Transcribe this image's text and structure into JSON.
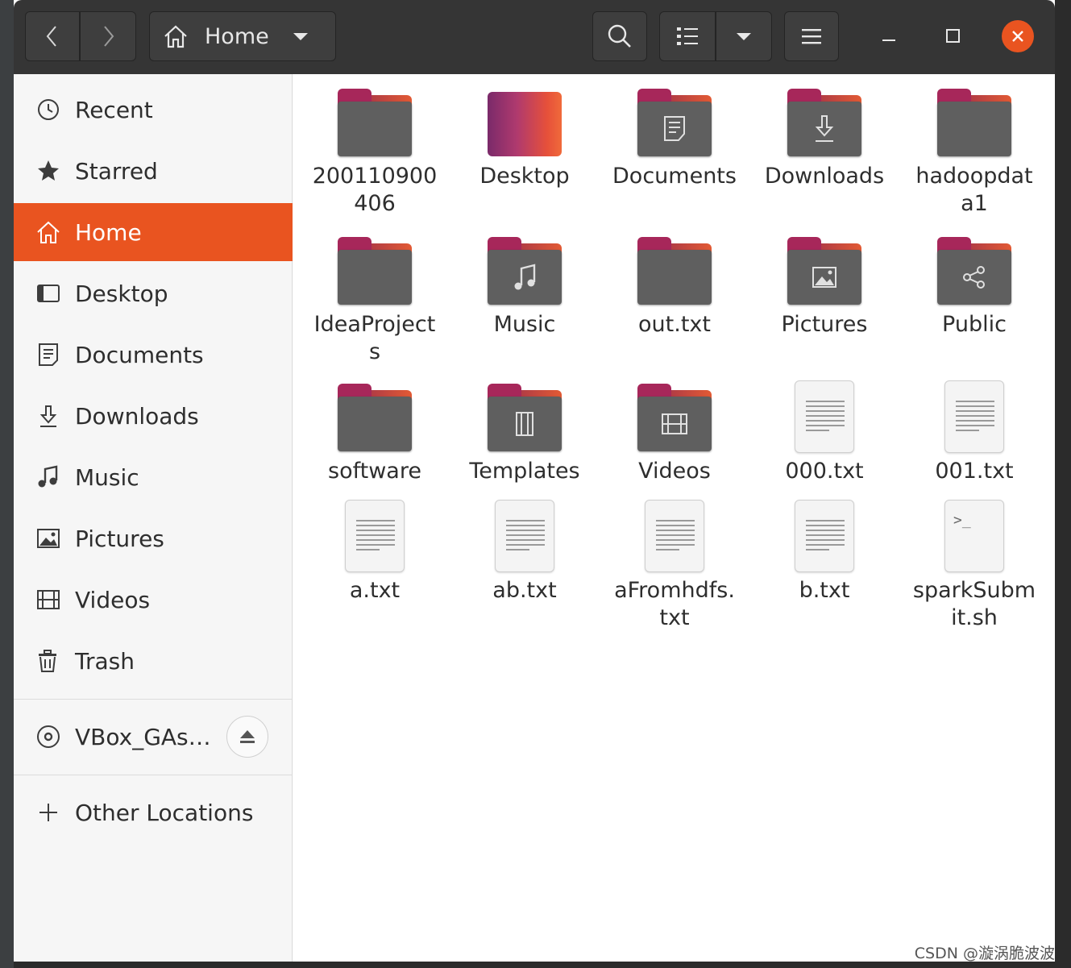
{
  "headerbar": {
    "path_label": "Home",
    "back_icon": "chevron-left-icon",
    "forward_icon": "chevron-right-icon",
    "search_icon": "search-icon",
    "view_icon": "list-view-icon",
    "menu_icon": "hamburger-menu-icon",
    "close_color": "#e95420"
  },
  "sidebar": {
    "items": [
      {
        "label": "Recent",
        "icon": "clock-icon"
      },
      {
        "label": "Starred",
        "icon": "star-icon"
      },
      {
        "label": "Home",
        "icon": "home-icon",
        "active": true
      },
      {
        "label": "Desktop",
        "icon": "desktop-icon"
      },
      {
        "label": "Documents",
        "icon": "document-icon"
      },
      {
        "label": "Downloads",
        "icon": "download-icon"
      },
      {
        "label": "Music",
        "icon": "music-icon"
      },
      {
        "label": "Pictures",
        "icon": "picture-icon"
      },
      {
        "label": "Videos",
        "icon": "video-icon"
      },
      {
        "label": "Trash",
        "icon": "trash-icon"
      }
    ],
    "device": {
      "label": "VBox_GAs…",
      "icon": "disc-icon",
      "eject_icon": "eject-icon"
    },
    "other_locations": {
      "label": "Other Locations",
      "icon": "plus-icon"
    }
  },
  "files": [
    {
      "name": "200110900406",
      "lines": [
        "200110900",
        "406"
      ],
      "kind": "folder"
    },
    {
      "name": "Desktop",
      "lines": [
        "Desktop"
      ],
      "kind": "desktop"
    },
    {
      "name": "Documents",
      "lines": [
        "Documents"
      ],
      "kind": "folder",
      "emblem": "document-icon"
    },
    {
      "name": "Downloads",
      "lines": [
        "Downloads"
      ],
      "kind": "folder",
      "emblem": "download-icon"
    },
    {
      "name": "hadoopdata1",
      "lines": [
        "hadoopdat",
        "a1"
      ],
      "kind": "folder"
    },
    {
      "name": "IdeaProjects",
      "lines": [
        "IdeaProject",
        "s"
      ],
      "kind": "folder"
    },
    {
      "name": "Music",
      "lines": [
        "Music"
      ],
      "kind": "folder",
      "emblem": "music-icon"
    },
    {
      "name": "out.txt",
      "lines": [
        "out.txt"
      ],
      "kind": "folder"
    },
    {
      "name": "Pictures",
      "lines": [
        "Pictures"
      ],
      "kind": "folder",
      "emblem": "picture-icon"
    },
    {
      "name": "Public",
      "lines": [
        "Public"
      ],
      "kind": "folder",
      "emblem": "share-icon"
    },
    {
      "name": "software",
      "lines": [
        "software"
      ],
      "kind": "folder"
    },
    {
      "name": "Templates",
      "lines": [
        "Templates"
      ],
      "kind": "folder",
      "emblem": "template-icon"
    },
    {
      "name": "Videos",
      "lines": [
        "Videos"
      ],
      "kind": "folder",
      "emblem": "video-icon"
    },
    {
      "name": "000.txt",
      "lines": [
        "000.txt"
      ],
      "kind": "text"
    },
    {
      "name": "001.txt",
      "lines": [
        "001.txt"
      ],
      "kind": "text"
    },
    {
      "name": "a.txt",
      "lines": [
        "a.txt"
      ],
      "kind": "text"
    },
    {
      "name": "ab.txt",
      "lines": [
        "ab.txt"
      ],
      "kind": "text"
    },
    {
      "name": "aFromhdfs.txt",
      "lines": [
        "aFromhdfs.",
        "txt"
      ],
      "kind": "text"
    },
    {
      "name": "b.txt",
      "lines": [
        "b.txt"
      ],
      "kind": "text"
    },
    {
      "name": "sparkSubmit.sh",
      "lines": [
        "sparkSubm",
        "it.sh"
      ],
      "kind": "script",
      "glyph": ">_"
    }
  ],
  "watermark": "CSDN @漩涡脆波波",
  "colors": {
    "accent": "#e95420",
    "headerbar": "#353535",
    "folder": "#5f5f5f"
  }
}
